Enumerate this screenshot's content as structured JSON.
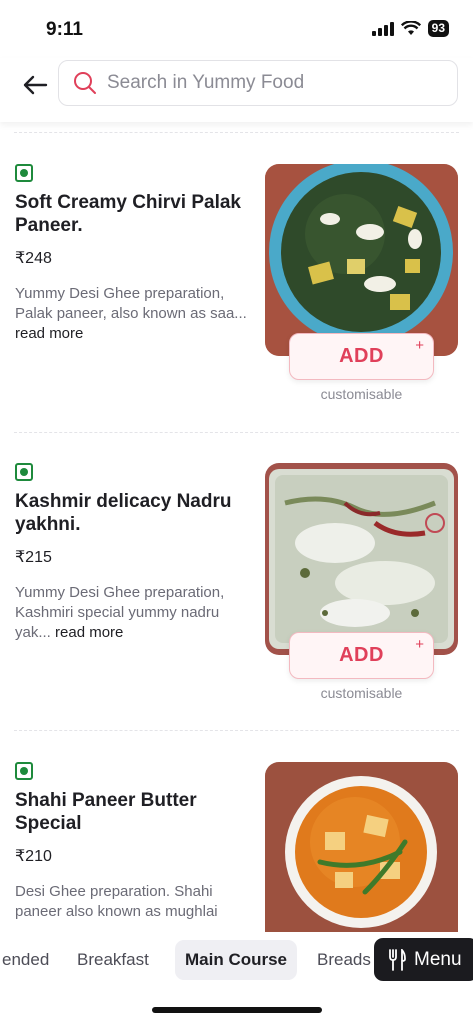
{
  "status_bar": {
    "time": "9:11",
    "battery": "93"
  },
  "header": {
    "search_placeholder": "Search in Yummy Food"
  },
  "dishes": [
    {
      "name": "Soft Creamy Chirvi Palak Paneer.",
      "price": "₹248",
      "description": "Yummy Desi Ghee preparation, Palak paneer, also known as saa...",
      "read_more": "read more",
      "add_label": "ADD",
      "add_plus": "+",
      "customisable": "customisable",
      "veg": true
    },
    {
      "name": "Kashmir delicacy Nadru yakhni.",
      "price": "₹215",
      "description": "Yummy Desi Ghee preparation, Kashmiri special yummy nadru yak...",
      "read_more": "read more",
      "add_label": "ADD",
      "add_plus": "+",
      "customisable": "customisable",
      "veg": true
    },
    {
      "name": "Shahi Paneer Butter Special",
      "price": "₹210",
      "description": "Desi Ghee preparation. Shahi paneer also known as mughlai",
      "veg": true
    }
  ],
  "tabs": [
    {
      "label": "ended",
      "active": false
    },
    {
      "label": "Breakfast",
      "active": false
    },
    {
      "label": "Main Course",
      "active": true
    },
    {
      "label": "Breads",
      "active": false
    }
  ],
  "menu_button": {
    "label": "Menu",
    "icon": "fork-knife-icon"
  },
  "colors": {
    "accent": "#e0405a",
    "add_bg": "#fff5f6",
    "veg_green": "#1e8a3c",
    "menu_bg": "#1b1b1f"
  }
}
